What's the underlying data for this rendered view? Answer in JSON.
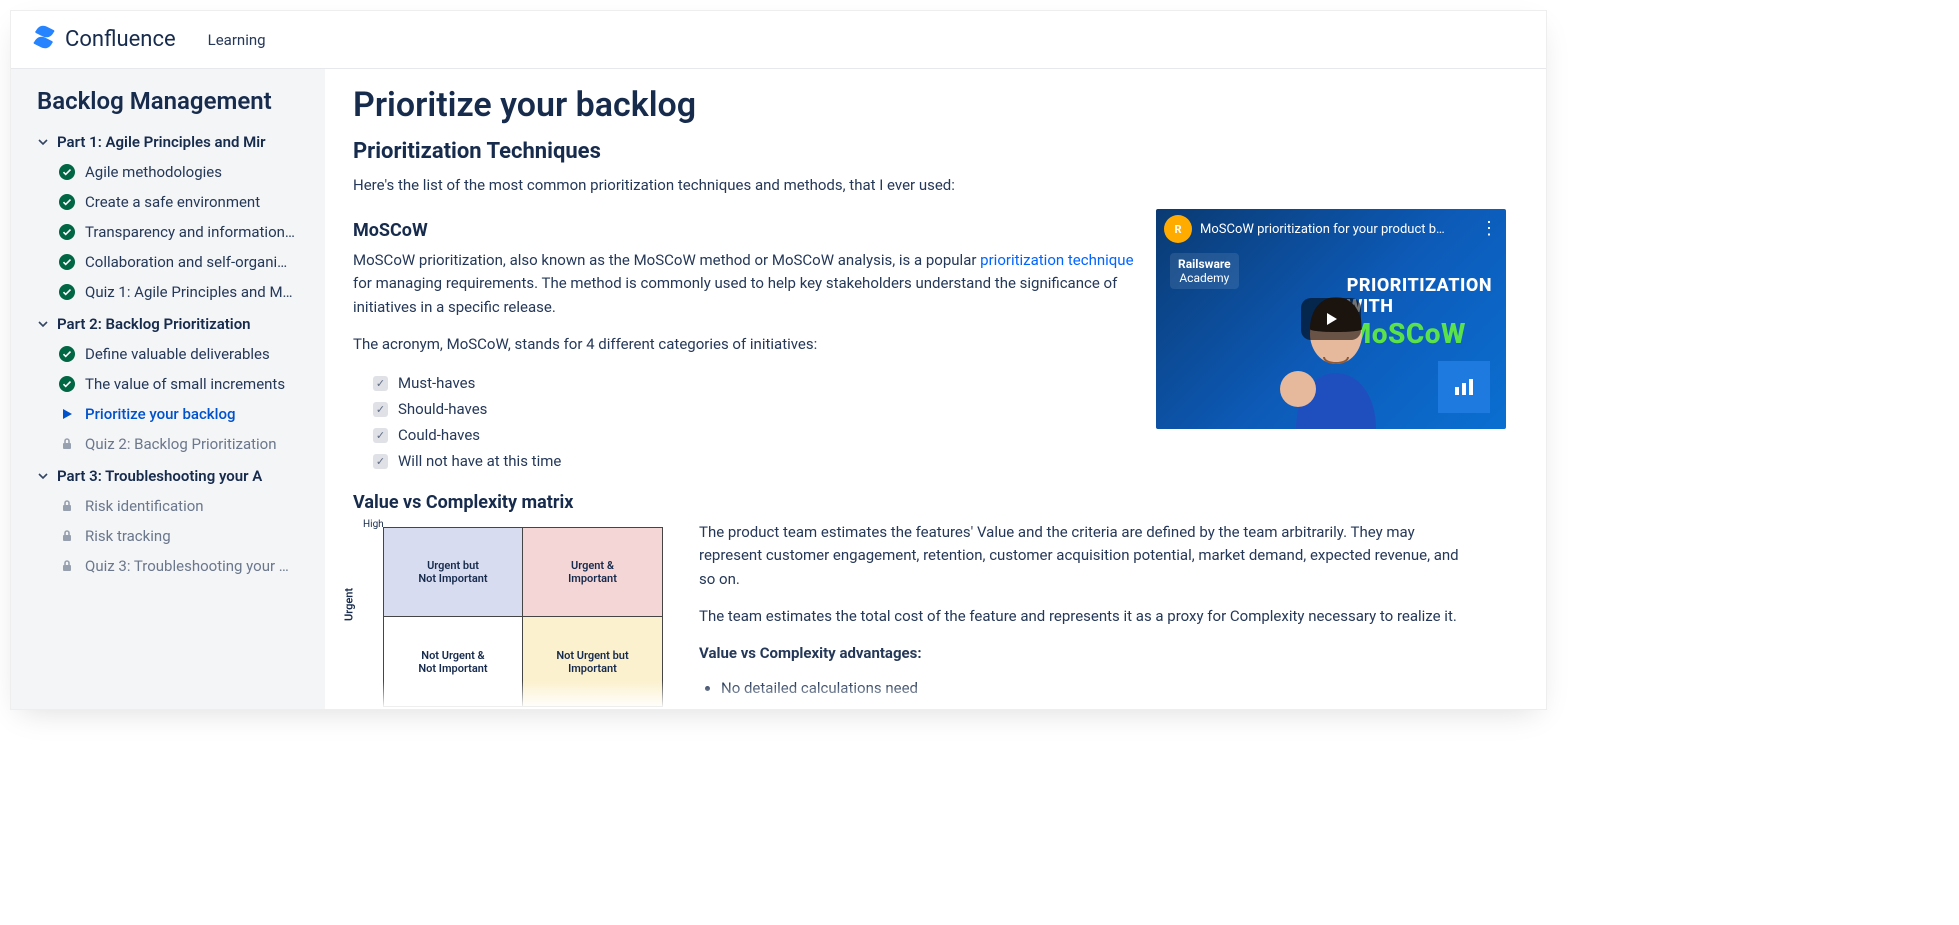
{
  "brand": {
    "name": "Confluence",
    "nav_learning": "Learning"
  },
  "sidebar": {
    "title": "Backlog Management",
    "parts": [
      {
        "label": "Part 1: Agile Principles and Mir",
        "items": [
          {
            "status": "done",
            "label": "Agile methodologies"
          },
          {
            "status": "done",
            "label": "Create a safe environment"
          },
          {
            "status": "done",
            "label": "Transparency and information…"
          },
          {
            "status": "done",
            "label": "Collaboration and self-organi…"
          },
          {
            "status": "done",
            "label": "Quiz 1: Agile Principles and M…"
          }
        ]
      },
      {
        "label": "Part 2: Backlog Prioritization",
        "items": [
          {
            "status": "done",
            "label": "Define valuable deliverables"
          },
          {
            "status": "done",
            "label": "The value of small increments"
          },
          {
            "status": "current",
            "label": "Prioritize your backlog"
          },
          {
            "status": "locked",
            "label": "Quiz 2: Backlog Prioritization"
          }
        ]
      },
      {
        "label": "Part 3: Troubleshooting your A",
        "items": [
          {
            "status": "locked",
            "label": "Risk identification"
          },
          {
            "status": "locked",
            "label": "Risk tracking"
          },
          {
            "status": "locked",
            "label": "Quiz 3: Troubleshooting your …"
          }
        ]
      }
    ]
  },
  "page": {
    "title": "Prioritize your backlog",
    "subhead": "Prioritization Techniques",
    "intro": "Here's the list of the most common prioritization techniques and methods, that I ever used:",
    "moscow": {
      "heading": "MoSCoW",
      "p1a": "MoSCoW prioritization, also known as the MoSCoW method or MoSCoW analysis, is a popular ",
      "link": "prioritization technique",
      "p1b": " for managing requirements. The method is commonly used to help key stakeholders understand the significance of initiatives in a specific release.",
      "p2": "The acronym, MoSCoW, stands for 4 different categories of initiatives:",
      "items": [
        "Must-haves",
        "Should-haves",
        "Could-haves",
        "Will not have at this time"
      ]
    },
    "vcc": {
      "heading": "Value vs Complexity matrix",
      "p1": "The product team estimates the features' Value and the criteria are defined by the team arbitrarily. They may represent customer engagement, retention, customer acquisition potential, market demand, expected revenue, and so on.",
      "p2": "The team estimates the total cost of the feature and represents it as a proxy for Complexity necessary to realize it.",
      "adv_heading": "Value vs Complexity advantages:",
      "adv1": "No detailed calculations need",
      "matrix": {
        "ylabel": "Urgent",
        "high": "High",
        "q1": "Urgent but\nNot Important",
        "q2": "Urgent &\nImportant",
        "q3": "Not Urgent &\nNot Important",
        "q4": "Not Urgent but\nImportant"
      }
    },
    "video": {
      "title": "MoSCoW prioritization for your product b…",
      "badge_top": "Railsware",
      "badge_bottom": "Academy",
      "headline_l1": "PRIORITIZATION",
      "headline_l2": "WITH",
      "headline_l3": "MoSCoW"
    }
  }
}
